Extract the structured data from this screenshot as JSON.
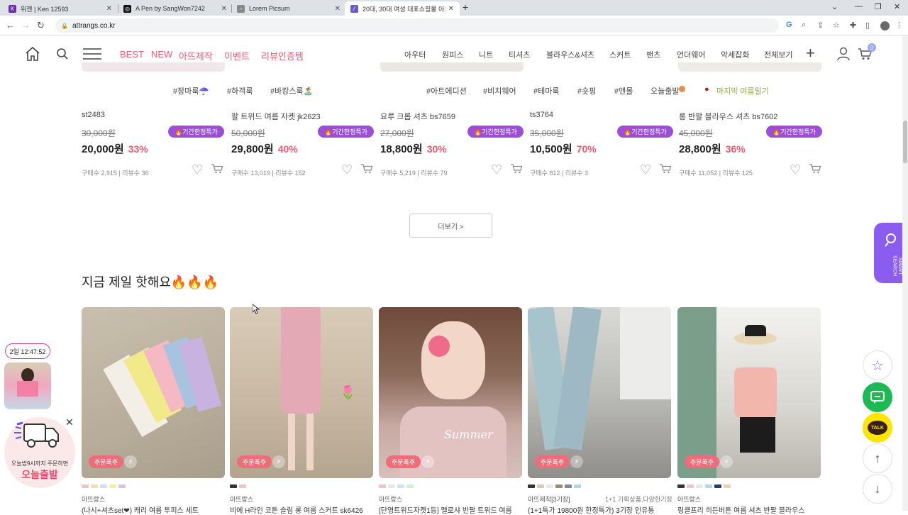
{
  "browser": {
    "tabs": [
      {
        "title": "위젠 | Ken 12593",
        "favicon": "K",
        "color": "#6b2fa3"
      },
      {
        "title": "A Pen by SangWon7242",
        "favicon": "◎",
        "color": "#111111"
      },
      {
        "title": "Lorem Picsum",
        "favicon": "▫",
        "color": "#888888"
      },
      {
        "title": "20대, 30대 여성 대표쇼핑몰 아트",
        "favicon": "⁄",
        "color": "#6a5acd"
      }
    ],
    "url": "attrangs.co.kr"
  },
  "header": {
    "menu_left": [
      {
        "label": "BEST",
        "color": "#ef5b6e"
      },
      {
        "label": "NEW",
        "color": "#ef5b6e"
      },
      {
        "label": "아뜨제작",
        "color": "#ef5b6e"
      },
      {
        "label": "이벤트",
        "color": "#ef5b6e"
      },
      {
        "label": "리뷰인증템",
        "color": "#ef5b6e"
      }
    ],
    "menu_right": [
      "아우터",
      "원피스",
      "니트",
      "티셔츠",
      "블라우스&셔츠",
      "스커트",
      "팬츠",
      "언더웨어",
      "악세잡화",
      "전체보기"
    ],
    "cart_count": "0"
  },
  "tags": [
    "#장마룩☂️",
    "#하객룩",
    "#바캉스룩🏝️",
    "#아트에디션",
    "#비치웨어",
    "#테마룩",
    "#숏핑",
    "#앤몰",
    "오늘출발",
    "마지막 여름털기"
  ],
  "products_top": [
    {
      "name": "st2483",
      "orig": "30,000원",
      "price": "20,000원",
      "discount": "33%",
      "promo": "🔥기간한정특가",
      "stats": "구매수 2,915 | 리뷰수 36"
    },
    {
      "name": "팔 트위드 여름 자켓 jk2623",
      "orig": "50,000원",
      "price": "29,800원",
      "discount": "40%",
      "promo": "🔥기간한정특가",
      "stats": "구매수 13,019 | 리뷰수 152"
    },
    {
      "name": "요루 크롭 셔츠 bs7659",
      "orig": "27,000원",
      "price": "18,800원",
      "discount": "30%",
      "promo": "🔥기간한정특가",
      "stats": "구매수 5,219 | 리뷰수 79"
    },
    {
      "name": "ts3764",
      "orig": "35,000원",
      "price": "10,500원",
      "discount": "70%",
      "promo": "🔥기간한정특가",
      "stats": "구매수 812 | 리뷰수 3"
    },
    {
      "name": "롱 반팔 블라우스 셔츠 bs7602",
      "orig": "45,000원",
      "price": "28,800원",
      "discount": "36%",
      "promo": "🔥기간한정특가",
      "stats": "구매수 11,052 | 리뷰수 125"
    }
  ],
  "more_button": "더보기 >",
  "hot_section": {
    "title": "지금 제일 핫해요🔥🔥🔥",
    "cards": [
      {
        "badge": "주문폭주",
        "brand": "아뜨랑스",
        "extra": "",
        "name": "(나시+셔츠set❤) 캐리 여름 투피스 세트",
        "swatches": [
          "#f3c3cc",
          "#f0e0b0",
          "#cfe2f0",
          "#f0f0a0",
          "#d8c0e8"
        ]
      },
      {
        "badge": "주문폭주",
        "brand": "아뜨랑스",
        "extra": "",
        "name": "비에 H라인 코튼 슬림 롱 여름 스커트 sk6426",
        "swatches": [
          "#333333",
          "#f3c3cc"
        ]
      },
      {
        "badge": "주문폭주",
        "brand": "아뜨랑스",
        "extra": "",
        "name": "[단영트위드자켓1등] 멜로샤 반팔 트위드 여름",
        "swatches": [
          "#f3c3cc",
          "#e8e8e8",
          "#cfe2f0",
          "#d0f0d0"
        ]
      },
      {
        "badge": "주문폭주",
        "brand": "아뜨제작[3기장]",
        "extra": "1+1 기획상품,다양한기장",
        "name": "(1+1특가 19800원 한정특가) 3기장 인유통",
        "swatches": [
          "#333333",
          "#d9cbb0",
          "#e8e8e8",
          "#a08a6a",
          "#7a8a9a",
          "#b0d8e8"
        ]
      },
      {
        "badge": "주문폭주",
        "brand": "아뜨랑스",
        "extra": "",
        "name": "링클프리 히든버튼 여름 셔츠 반팔 블라우스",
        "swatches": [
          "#333333",
          "#f3c3cc",
          "#e8e8e8",
          "#b0d8e8",
          "#2a3a6a",
          "#f0d0b0"
        ]
      }
    ]
  },
  "widgets": {
    "smart_search": "SMART SEARCH",
    "timer": "2일 12:47:52",
    "delivery_line1": "오늘밤9시까지 주문하면",
    "delivery_line2": "오늘출발",
    "talk": "TALK"
  }
}
